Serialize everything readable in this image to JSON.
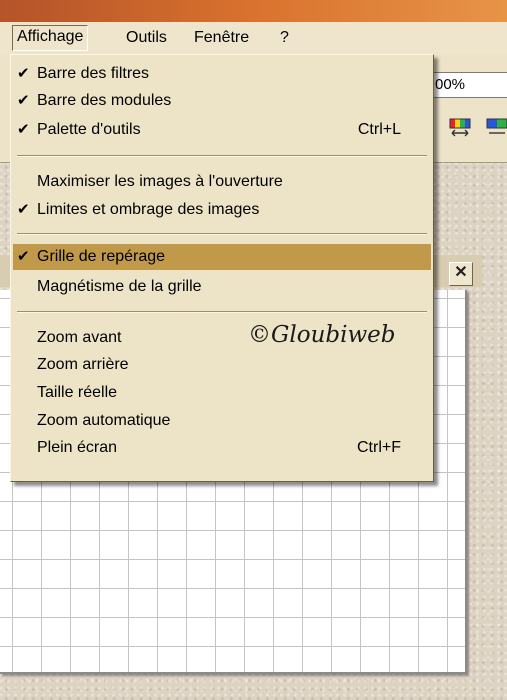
{
  "menubar": {
    "items": [
      {
        "label": "Affichage",
        "active": true
      },
      {
        "label": "Outils"
      },
      {
        "label": "Fenêtre"
      },
      {
        "label": "?"
      }
    ]
  },
  "toolbar": {
    "zoom_value": "00%",
    "icons": [
      "color-palette-icon",
      "color-palette-icon"
    ]
  },
  "menu": {
    "group1": [
      {
        "check": "✔",
        "label": "Barre des filtres",
        "shortcut": ""
      },
      {
        "check": "✔",
        "label": "Barre des modules",
        "shortcut": ""
      },
      {
        "check": "✔",
        "label": "Palette d'outils",
        "shortcut": "Ctrl+L"
      }
    ],
    "group2": [
      {
        "check": "",
        "label": "Maximiser les images à l'ouverture",
        "shortcut": ""
      },
      {
        "check": "✔",
        "label": "Limites et ombrage des images",
        "shortcut": ""
      }
    ],
    "group3": [
      {
        "check": "✔",
        "label": "Grille de repérage",
        "shortcut": "",
        "highlighted": true
      },
      {
        "check": "",
        "label": "Magnétisme de la grille",
        "shortcut": ""
      }
    ],
    "group4": [
      {
        "check": "",
        "label": "Zoom avant",
        "shortcut": ""
      },
      {
        "check": "",
        "label": "Zoom arrière",
        "shortcut": ""
      },
      {
        "check": "",
        "label": "Taille réelle",
        "shortcut": ""
      },
      {
        "check": "",
        "label": "Zoom automatique",
        "shortcut": ""
      },
      {
        "check": "",
        "label": "Plein écran",
        "shortcut": "Ctrl+F"
      }
    ]
  },
  "document": {
    "close_label": "✕"
  },
  "watermark": "©Gloubiweb",
  "colors": {
    "title_bar": "#d9722e",
    "menu_bg": "#ede4c8",
    "highlight": "#c09a4a"
  }
}
